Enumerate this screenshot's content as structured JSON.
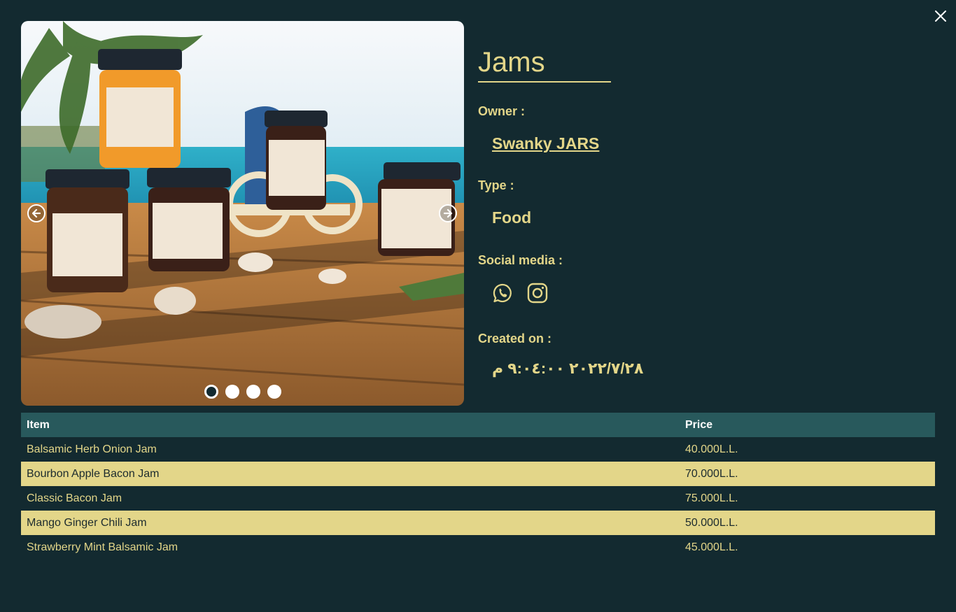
{
  "title": "Jams",
  "owner_label": "Owner :",
  "owner_name": "Swanky JARS",
  "type_label": "Type :",
  "type_value": "Food",
  "social_label": "Social media :",
  "social_icons": [
    "whatsapp-icon",
    "instagram-icon"
  ],
  "created_label": "Created on :",
  "created_value": "٢٠٢٢/٧/٢٨ ٩:٠٤:٠٠ م",
  "carousel": {
    "slides": 4,
    "active_slide": 1
  },
  "table": {
    "headers": {
      "item": "Item",
      "price": "Price"
    },
    "rows": [
      {
        "item": "Balsamic Herb Onion Jam",
        "price": "40.000L.L."
      },
      {
        "item": "Bourbon Apple Bacon Jam",
        "price": "70.000L.L."
      },
      {
        "item": "Classic Bacon Jam",
        "price": "75.000L.L."
      },
      {
        "item": "Mango Ginger Chili Jam",
        "price": "50.000L.L."
      },
      {
        "item": "Strawberry Mint Balsamic Jam",
        "price": "45.000L.L."
      }
    ]
  },
  "colors": {
    "background": "#132a30",
    "accent": "#e3d689",
    "table_header": "#28595c"
  }
}
